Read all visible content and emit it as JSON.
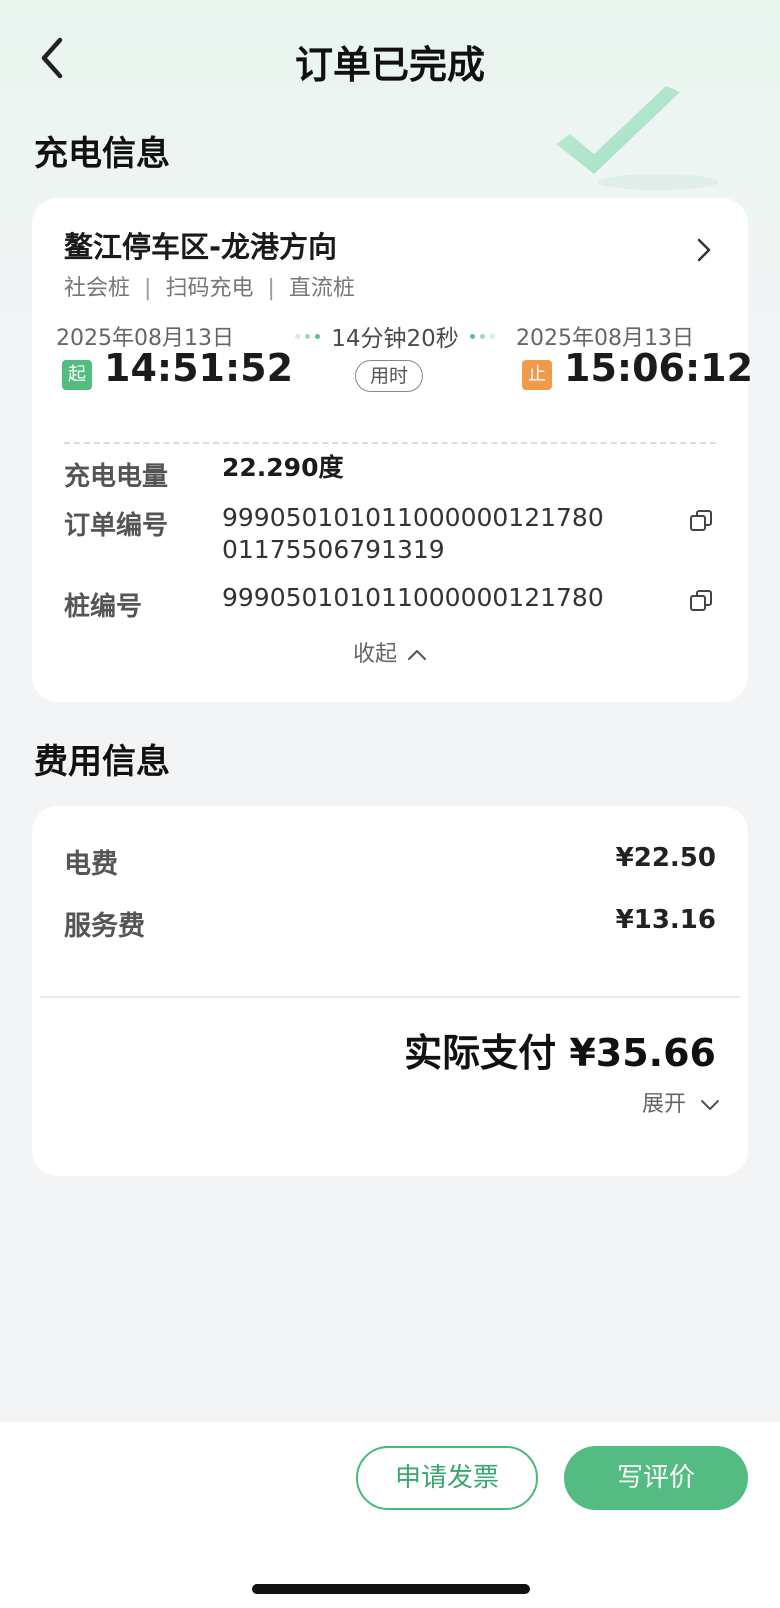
{
  "header": {
    "title": "订单已完成"
  },
  "charge_section": {
    "title": "充电信息",
    "station": {
      "name": "鳌江停车区-龙港方向",
      "tags": [
        "社会桩",
        "扫码充电",
        "直流桩"
      ]
    },
    "start": {
      "date": "2025年08月13日",
      "tag": "起",
      "time": "14:51:52"
    },
    "duration": {
      "text": "14分钟20秒",
      "badge": "用时"
    },
    "end": {
      "date": "2025年08月13日",
      "tag": "止",
      "time": "15:06:12"
    },
    "details": [
      {
        "label": "充电电量",
        "value": "22.290度"
      },
      {
        "label": "订单编号",
        "value_line1": "999050101011000000121780",
        "value_line2": "01175506791319"
      },
      {
        "label": "桩编号",
        "value": "999050101011000000121780"
      }
    ],
    "collapse_label": "收起"
  },
  "fee_section": {
    "title": "费用信息",
    "items": [
      {
        "label": "电费",
        "value": "¥22.50"
      },
      {
        "label": "服务费",
        "value": "¥13.16"
      }
    ],
    "total": "实际支付 ¥35.66",
    "expand_label": "展开"
  },
  "actions": {
    "invoice_label": "申请发票",
    "review_label": "写评价"
  },
  "colors": {
    "accent": "#54bc82",
    "start_tag": "#52bd7f",
    "end_tag": "#f09a4a"
  },
  "icons": [
    "back-arrow-icon",
    "check-icon",
    "chevron-right-icon",
    "copy-icon",
    "chevron-up-icon",
    "chevron-down-icon"
  ]
}
